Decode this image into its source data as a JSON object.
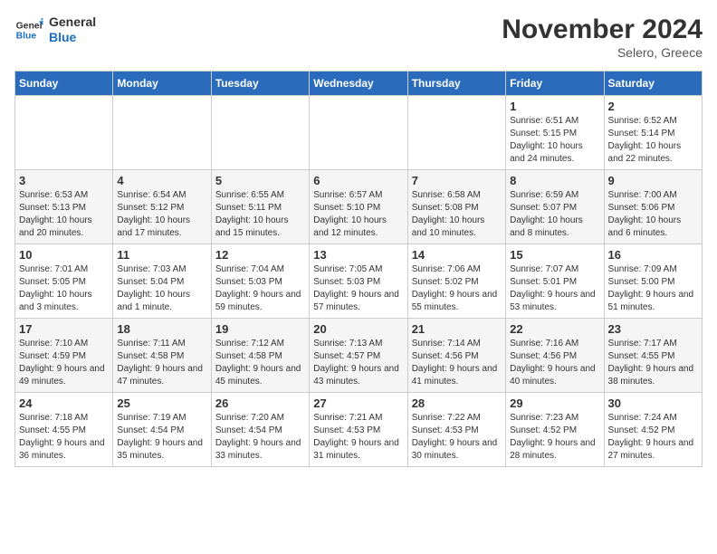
{
  "logo": {
    "name_part1": "General",
    "name_part2": "Blue"
  },
  "header": {
    "month": "November 2024",
    "location": "Selero, Greece"
  },
  "weekdays": [
    "Sunday",
    "Monday",
    "Tuesday",
    "Wednesday",
    "Thursday",
    "Friday",
    "Saturday"
  ],
  "weeks": [
    [
      {
        "day": "",
        "info": ""
      },
      {
        "day": "",
        "info": ""
      },
      {
        "day": "",
        "info": ""
      },
      {
        "day": "",
        "info": ""
      },
      {
        "day": "",
        "info": ""
      },
      {
        "day": "1",
        "info": "Sunrise: 6:51 AM\nSunset: 5:15 PM\nDaylight: 10 hours and 24 minutes."
      },
      {
        "day": "2",
        "info": "Sunrise: 6:52 AM\nSunset: 5:14 PM\nDaylight: 10 hours and 22 minutes."
      }
    ],
    [
      {
        "day": "3",
        "info": "Sunrise: 6:53 AM\nSunset: 5:13 PM\nDaylight: 10 hours and 20 minutes."
      },
      {
        "day": "4",
        "info": "Sunrise: 6:54 AM\nSunset: 5:12 PM\nDaylight: 10 hours and 17 minutes."
      },
      {
        "day": "5",
        "info": "Sunrise: 6:55 AM\nSunset: 5:11 PM\nDaylight: 10 hours and 15 minutes."
      },
      {
        "day": "6",
        "info": "Sunrise: 6:57 AM\nSunset: 5:10 PM\nDaylight: 10 hours and 12 minutes."
      },
      {
        "day": "7",
        "info": "Sunrise: 6:58 AM\nSunset: 5:08 PM\nDaylight: 10 hours and 10 minutes."
      },
      {
        "day": "8",
        "info": "Sunrise: 6:59 AM\nSunset: 5:07 PM\nDaylight: 10 hours and 8 minutes."
      },
      {
        "day": "9",
        "info": "Sunrise: 7:00 AM\nSunset: 5:06 PM\nDaylight: 10 hours and 6 minutes."
      }
    ],
    [
      {
        "day": "10",
        "info": "Sunrise: 7:01 AM\nSunset: 5:05 PM\nDaylight: 10 hours and 3 minutes."
      },
      {
        "day": "11",
        "info": "Sunrise: 7:03 AM\nSunset: 5:04 PM\nDaylight: 10 hours and 1 minute."
      },
      {
        "day": "12",
        "info": "Sunrise: 7:04 AM\nSunset: 5:03 PM\nDaylight: 9 hours and 59 minutes."
      },
      {
        "day": "13",
        "info": "Sunrise: 7:05 AM\nSunset: 5:03 PM\nDaylight: 9 hours and 57 minutes."
      },
      {
        "day": "14",
        "info": "Sunrise: 7:06 AM\nSunset: 5:02 PM\nDaylight: 9 hours and 55 minutes."
      },
      {
        "day": "15",
        "info": "Sunrise: 7:07 AM\nSunset: 5:01 PM\nDaylight: 9 hours and 53 minutes."
      },
      {
        "day": "16",
        "info": "Sunrise: 7:09 AM\nSunset: 5:00 PM\nDaylight: 9 hours and 51 minutes."
      }
    ],
    [
      {
        "day": "17",
        "info": "Sunrise: 7:10 AM\nSunset: 4:59 PM\nDaylight: 9 hours and 49 minutes."
      },
      {
        "day": "18",
        "info": "Sunrise: 7:11 AM\nSunset: 4:58 PM\nDaylight: 9 hours and 47 minutes."
      },
      {
        "day": "19",
        "info": "Sunrise: 7:12 AM\nSunset: 4:58 PM\nDaylight: 9 hours and 45 minutes."
      },
      {
        "day": "20",
        "info": "Sunrise: 7:13 AM\nSunset: 4:57 PM\nDaylight: 9 hours and 43 minutes."
      },
      {
        "day": "21",
        "info": "Sunrise: 7:14 AM\nSunset: 4:56 PM\nDaylight: 9 hours and 41 minutes."
      },
      {
        "day": "22",
        "info": "Sunrise: 7:16 AM\nSunset: 4:56 PM\nDaylight: 9 hours and 40 minutes."
      },
      {
        "day": "23",
        "info": "Sunrise: 7:17 AM\nSunset: 4:55 PM\nDaylight: 9 hours and 38 minutes."
      }
    ],
    [
      {
        "day": "24",
        "info": "Sunrise: 7:18 AM\nSunset: 4:55 PM\nDaylight: 9 hours and 36 minutes."
      },
      {
        "day": "25",
        "info": "Sunrise: 7:19 AM\nSunset: 4:54 PM\nDaylight: 9 hours and 35 minutes."
      },
      {
        "day": "26",
        "info": "Sunrise: 7:20 AM\nSunset: 4:54 PM\nDaylight: 9 hours and 33 minutes."
      },
      {
        "day": "27",
        "info": "Sunrise: 7:21 AM\nSunset: 4:53 PM\nDaylight: 9 hours and 31 minutes."
      },
      {
        "day": "28",
        "info": "Sunrise: 7:22 AM\nSunset: 4:53 PM\nDaylight: 9 hours and 30 minutes."
      },
      {
        "day": "29",
        "info": "Sunrise: 7:23 AM\nSunset: 4:52 PM\nDaylight: 9 hours and 28 minutes."
      },
      {
        "day": "30",
        "info": "Sunrise: 7:24 AM\nSunset: 4:52 PM\nDaylight: 9 hours and 27 minutes."
      }
    ]
  ]
}
